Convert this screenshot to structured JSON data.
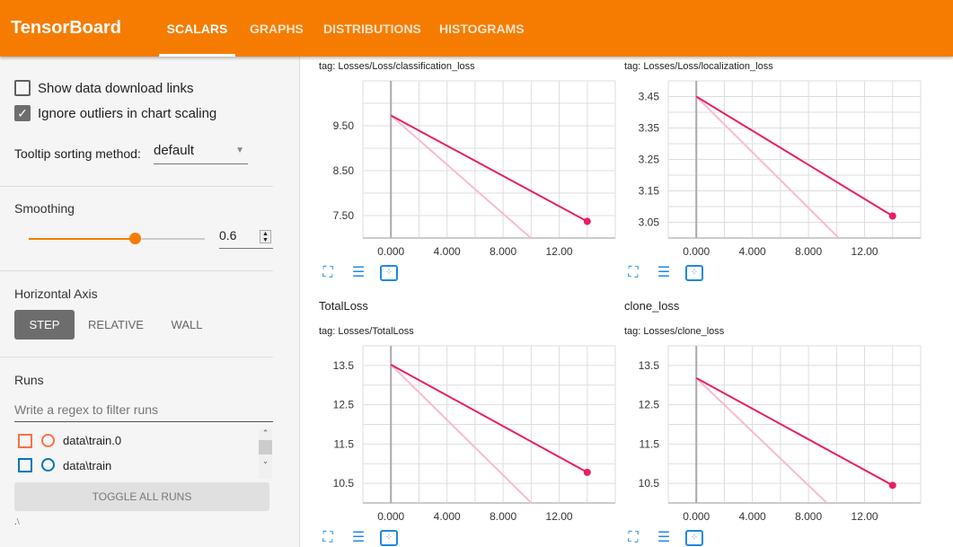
{
  "header": {
    "title": "TensorBoard",
    "tabs": [
      {
        "label": "SCALARS",
        "active": true
      },
      {
        "label": "GRAPHS"
      },
      {
        "label": "DISTRIBUTIONS"
      },
      {
        "label": "HISTOGRAMS"
      }
    ]
  },
  "sidebar": {
    "show_download": {
      "label": "Show data download links",
      "checked": false
    },
    "ignore_outliers": {
      "label": "Ignore outliers in chart scaling",
      "checked": true
    },
    "tooltip": {
      "label": "Tooltip sorting method:",
      "value": "default"
    },
    "smoothing": {
      "label": "Smoothing",
      "value": "0.6",
      "fraction": 0.6
    },
    "haxis": {
      "label": "Horizontal Axis",
      "options": [
        "STEP",
        "RELATIVE",
        "WALL"
      ],
      "selected": "STEP"
    },
    "runs": {
      "label": "Runs",
      "filter_placeholder": "Write a regex to filter runs",
      "items": [
        {
          "name": "data\\train.0",
          "color": "#ff7043"
        },
        {
          "name": "data\\train",
          "color": "#0077bb"
        }
      ],
      "toggle_label": "TOGGLE ALL RUNS",
      "footer": ".\\"
    }
  },
  "colors": {
    "accent": "#f57c00",
    "series": "#e91e63"
  },
  "chart_data": [
    {
      "type": "line",
      "title": "",
      "tag": "tag: Losses/Loss/classification_loss",
      "xlim": [
        -2,
        16
      ],
      "ylim": [
        7.0,
        10.5
      ],
      "xticks": [
        "0.000",
        "4.000",
        "8.000",
        "12.00"
      ],
      "xtick_values": [
        0,
        4,
        8,
        12
      ],
      "yticks": [
        "7.50",
        "8.50",
        "9.50"
      ],
      "ytick_values": [
        7.5,
        8.5,
        9.5
      ],
      "smoothed": {
        "x": [
          0,
          14
        ],
        "y": [
          9.73,
          7.37
        ]
      },
      "raw": {
        "x": [
          0,
          14
        ],
        "y": [
          9.73,
          5.9
        ]
      }
    },
    {
      "type": "line",
      "title": "",
      "tag": "tag: Losses/Loss/localization_loss",
      "xlim": [
        -2,
        16
      ],
      "ylim": [
        3.0,
        3.5
      ],
      "xticks": [
        "0.000",
        "4.000",
        "8.000",
        "12.00"
      ],
      "xtick_values": [
        0,
        4,
        8,
        12
      ],
      "yticks": [
        "3.05",
        "3.15",
        "3.25",
        "3.35",
        "3.45"
      ],
      "ytick_values": [
        3.05,
        3.15,
        3.25,
        3.35,
        3.45
      ],
      "smoothed": {
        "x": [
          0,
          14
        ],
        "y": [
          3.45,
          3.07
        ]
      },
      "raw": {
        "x": [
          0,
          14
        ],
        "y": [
          3.45,
          2.83
        ]
      }
    },
    {
      "type": "line",
      "title": "TotalLoss",
      "tag": "tag: Losses/TotalLoss",
      "xlim": [
        -2,
        16
      ],
      "ylim": [
        10.0,
        14.0
      ],
      "xticks": [
        "0.000",
        "4.000",
        "8.000",
        "12.00"
      ],
      "xtick_values": [
        0,
        4,
        8,
        12
      ],
      "yticks": [
        "10.5",
        "11.5",
        "12.5",
        "13.5"
      ],
      "ytick_values": [
        10.5,
        11.5,
        12.5,
        13.5
      ],
      "smoothed": {
        "x": [
          0,
          14
        ],
        "y": [
          13.52,
          10.78
        ]
      },
      "raw": {
        "x": [
          0,
          14
        ],
        "y": [
          13.52,
          8.6
        ]
      }
    },
    {
      "type": "line",
      "title": "clone_loss",
      "tag": "tag: Losses/clone_loss",
      "xlim": [
        -2,
        16
      ],
      "ylim": [
        10.0,
        14.0
      ],
      "xticks": [
        "0.000",
        "4.000",
        "8.000",
        "12.00"
      ],
      "xtick_values": [
        0,
        4,
        8,
        12
      ],
      "yticks": [
        "10.5",
        "11.5",
        "12.5",
        "13.5"
      ],
      "ytick_values": [
        10.5,
        11.5,
        12.5,
        13.5
      ],
      "smoothed": {
        "x": [
          0,
          14
        ],
        "y": [
          13.18,
          10.45
        ]
      },
      "raw": {
        "x": [
          0,
          14
        ],
        "y": [
          13.18,
          8.4
        ]
      }
    }
  ]
}
